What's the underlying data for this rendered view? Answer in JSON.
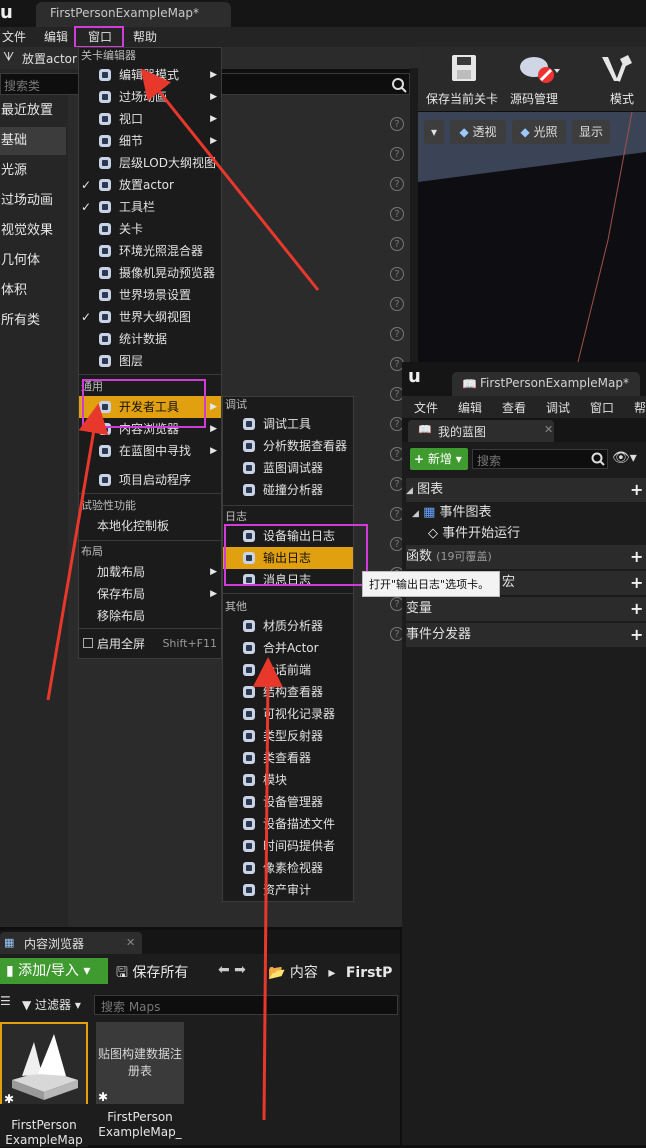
{
  "window": {
    "tab_title": "FirstPersonExampleMap*"
  },
  "menubar": {
    "file": "文件",
    "edit": "编辑",
    "window": "窗口",
    "help": "帮助"
  },
  "place_actor_label": "放置actor",
  "search_placeholder": "搜索类",
  "categories": [
    "最近放置",
    "基础",
    "光源",
    "过场动画",
    "视觉效果",
    "几何体",
    "体积",
    "所有类"
  ],
  "window_menu": {
    "section_level_editor": "关卡编辑器",
    "items_level": [
      {
        "label": "编辑器模式",
        "icon": "mode-icon",
        "submenu": true,
        "checked": false
      },
      {
        "label": "过场动画",
        "icon": "film-icon",
        "submenu": true,
        "checked": false
      },
      {
        "label": "视口",
        "icon": "viewport-icon",
        "submenu": true,
        "checked": false
      },
      {
        "label": "细节",
        "icon": "details-icon",
        "submenu": true,
        "checked": false
      },
      {
        "label": "层级LOD大纲视图",
        "icon": "hlod-icon",
        "submenu": false,
        "checked": false
      },
      {
        "label": "放置actor",
        "icon": "place-actor-icon",
        "submenu": false,
        "checked": true
      },
      {
        "label": "工具栏",
        "icon": "toolbar-icon",
        "submenu": false,
        "checked": true
      },
      {
        "label": "关卡",
        "icon": "levels-icon",
        "submenu": false,
        "checked": false
      },
      {
        "label": "环境光照混合器",
        "icon": "env-light-icon",
        "submenu": false,
        "checked": false
      },
      {
        "label": "摄像机晃动预览器",
        "icon": "camera-shake-icon",
        "submenu": false,
        "checked": false
      },
      {
        "label": "世界场景设置",
        "icon": "world-settings-icon",
        "submenu": false,
        "checked": false
      },
      {
        "label": "世界大纲视图",
        "icon": "outliner-icon",
        "submenu": false,
        "checked": true
      },
      {
        "label": "统计数据",
        "icon": "stats-icon",
        "submenu": false,
        "checked": false
      },
      {
        "label": "图层",
        "icon": "layers-icon",
        "submenu": false,
        "checked": false
      }
    ],
    "section_general": "通用",
    "items_general": [
      {
        "label": "开发者工具",
        "icon": "dev-tools-icon",
        "submenu": true,
        "highlighted": true
      },
      {
        "label": "内容浏览器",
        "icon": "content-browser-icon",
        "submenu": true,
        "highlighted": false
      },
      {
        "label": "在蓝图中寻找",
        "icon": "find-blueprint-icon",
        "submenu": true,
        "highlighted": false
      },
      {
        "label": "项目启动程序",
        "icon": "project-launcher-icon",
        "submenu": false,
        "highlighted": false
      }
    ],
    "section_experimental": "试验性功能",
    "localization": "本地化控制板",
    "section_layout": "布局",
    "layout_items": [
      "加载布局",
      "保存布局",
      "移除布局"
    ],
    "fullscreen_label": "启用全屏",
    "fullscreen_shortcut": "Shift+F11"
  },
  "dev_tools_menu": {
    "section_debug": "调试",
    "debug_items": [
      {
        "label": "调试工具",
        "icon": "debug-tools-icon"
      },
      {
        "label": "分析数据查看器",
        "icon": "profiler-icon"
      },
      {
        "label": "蓝图调试器",
        "icon": "bp-debugger-icon"
      },
      {
        "label": "碰撞分析器",
        "icon": "collision-icon"
      }
    ],
    "section_log": "日志",
    "log_items": [
      {
        "label": "设备输出日志",
        "icon": "device-log-icon",
        "highlighted": false
      },
      {
        "label": "输出日志",
        "icon": "output-log-icon",
        "highlighted": true
      },
      {
        "label": "消息日志",
        "icon": "message-log-icon",
        "highlighted": false
      }
    ],
    "section_misc": "其他",
    "misc_items": [
      {
        "label": "材质分析器",
        "icon": "material-analyzer-icon"
      },
      {
        "label": "合并Actor",
        "icon": "merge-actor-icon"
      },
      {
        "label": "会话前端",
        "icon": "session-icon"
      },
      {
        "label": "结构查看器",
        "icon": "struct-viewer-icon"
      },
      {
        "label": "可视化记录器",
        "icon": "visual-logger-icon"
      },
      {
        "label": "类型反射器",
        "icon": "reflector-icon"
      },
      {
        "label": "类查看器",
        "icon": "class-viewer-icon"
      },
      {
        "label": "模块",
        "icon": "modules-icon"
      },
      {
        "label": "设备管理器",
        "icon": "device-manager-icon"
      },
      {
        "label": "设备描述文件",
        "icon": "device-profile-icon"
      },
      {
        "label": "时间码提供者",
        "icon": "timecode-icon"
      },
      {
        "label": "像素检视器",
        "icon": "pixel-inspector-icon"
      },
      {
        "label": "资产审计",
        "icon": "asset-audit-icon"
      }
    ]
  },
  "tooltip": "打开\"输出日志\"选项卡。",
  "toolbar": {
    "save": "保存当前关卡",
    "source": "源码管理",
    "modes": "模式"
  },
  "viewport": {
    "perspective": "透视",
    "lit": "光照",
    "show": "显示"
  },
  "blueprint_window": {
    "title": "FirstPersonExampleMap*",
    "menu": [
      "文件",
      "编辑",
      "查看",
      "调试",
      "窗口",
      "帮"
    ],
    "tab": "我的蓝图",
    "new_button": "新增",
    "search_placeholder": "搜索",
    "graph_label": "图表",
    "event_graph": "事件图表",
    "begin_play": "事件开始运行",
    "functions": "函数",
    "functions_count": "(19可覆盖)",
    "macros": "宏",
    "variables": "变量",
    "dispatchers": "事件分发器"
  },
  "content_browser": {
    "tab": "内容浏览器",
    "add_import": "添加/导入",
    "save_all": "保存所有",
    "path_root": "内容",
    "path_next": "FirstP",
    "filters": "过滤器",
    "search_placeholder": "搜索 Maps",
    "assets": [
      {
        "label": "FirstPerson ExampleMap",
        "thumb": "map-thumbnail"
      },
      {
        "label": "FirstPerson ExampleMap_",
        "thumb_text": "贴图构建数据注册表"
      }
    ]
  },
  "colors": {
    "accent_orange": "#e0a010",
    "highlight_pink": "#d03cd6",
    "arrow_red": "#e8382c",
    "add_green": "#3f9a2f"
  }
}
